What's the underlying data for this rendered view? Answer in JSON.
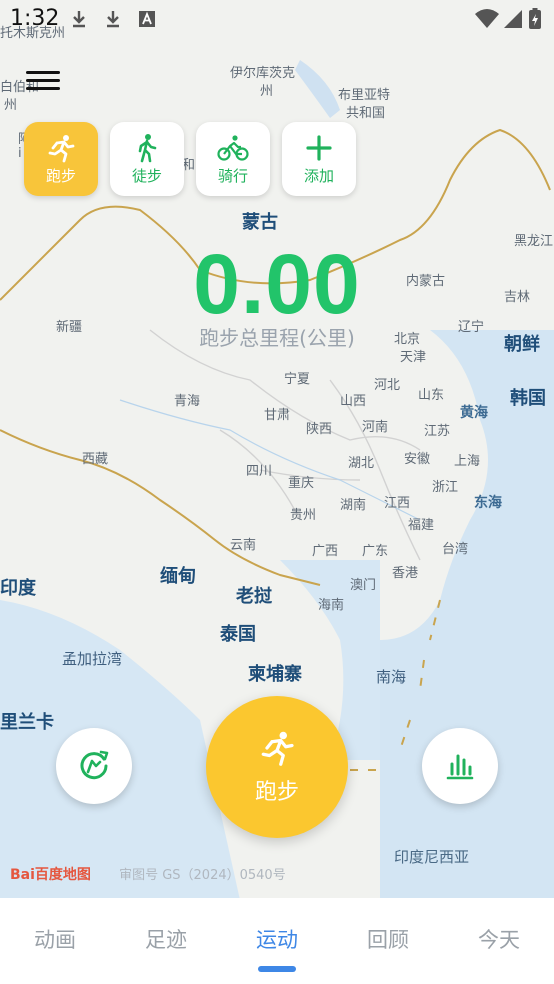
{
  "status": {
    "time": "1:32",
    "icons": [
      "download-icon",
      "download-icon",
      "text-a-icon",
      "wifi-icon",
      "signal-icon",
      "battery-icon"
    ]
  },
  "map": {
    "labels": {
      "l1": "托木斯克州",
      "l2": "伊尔库茨克",
      "l3": "州",
      "l4": "布里亚特",
      "l5": "共和国",
      "l6": "白伯和",
      "l7": "州",
      "l8": "阿",
      "l9": "i",
      "l10": "和",
      "l11": "蒙古",
      "l12": "黑龙江",
      "l13": "吉林",
      "l14": "内蒙古",
      "l15": "新疆",
      "l16": "辽宁",
      "l17": "朝鲜",
      "l18": "北京",
      "l19": "天津",
      "l20": "宁夏",
      "l21": "河北",
      "l22": "山东",
      "l23": "韩国",
      "l24": "青海",
      "l25": "甘肃",
      "l26": "山西",
      "l27": "黄海",
      "l28": "陕西",
      "l29": "河南",
      "l30": "江苏",
      "l31": "西藏",
      "l32": "湖北",
      "l33": "安徽",
      "l34": "上海",
      "l35": "四川",
      "l36": "重庆",
      "l37": "浙江",
      "l38": "东海",
      "l39": "湖南",
      "l40": "江西",
      "l41": "贵州",
      "l42": "福建",
      "l43": "云南",
      "l44": "广西",
      "l45": "广东",
      "l46": "台湾",
      "l47": "缅甸",
      "l48": "香港",
      "l49": "澳门",
      "l50": "印度",
      "l51": "老挝",
      "l52": "海南",
      "l53": "泰国",
      "l54": "孟加拉湾",
      "l55": "柬埔寨",
      "l56": "南海",
      "l57": "里兰卡",
      "l58": "印度尼西亚"
    },
    "colors": {
      "land": "#f2f3f0",
      "sea": "#d5e6f4",
      "border": "#c9a44e"
    }
  },
  "sport_tabs": [
    {
      "label": "跑步",
      "icon": "running-icon"
    },
    {
      "label": "徒步",
      "icon": "walking-icon"
    },
    {
      "label": "骑行",
      "icon": "cycling-icon"
    },
    {
      "label": "添加",
      "icon": "plus-icon"
    }
  ],
  "stats": {
    "distance": "0.00",
    "distance_label": "跑步总里程(公里)"
  },
  "start_button": {
    "label": "跑步"
  },
  "watermark": {
    "logo": "Bai百度地图",
    "text": "审图号 GS（2024）0540号"
  },
  "bottom_nav": {
    "items": [
      "动画",
      "足迹",
      "运动",
      "回顾",
      "今天"
    ],
    "active": "运动"
  },
  "colors": {
    "accent_green": "#22c46a",
    "accent_yellow": "#fbc72f",
    "nav_active": "#3e87e6"
  }
}
